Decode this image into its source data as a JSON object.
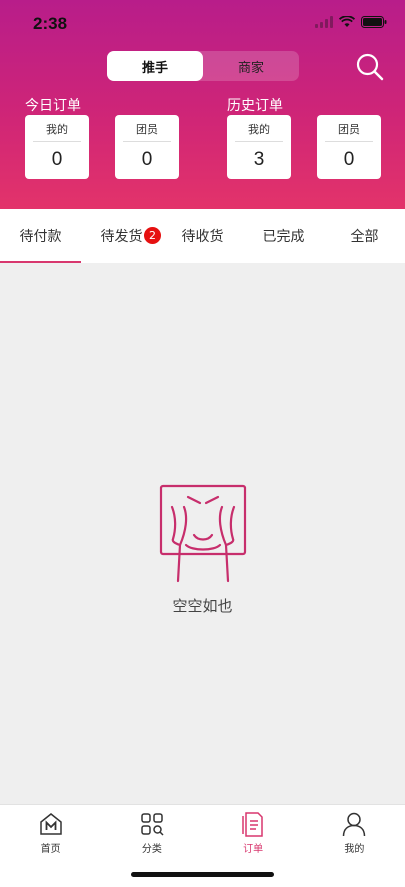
{
  "status_bar": {
    "time": "2:38"
  },
  "role_toggle": {
    "options": [
      "推手",
      "商家"
    ],
    "selected": "推手"
  },
  "today_orders": {
    "title": "今日订单",
    "cards": [
      {
        "label": "我的",
        "value": "0"
      },
      {
        "label": "团员",
        "value": "0"
      }
    ]
  },
  "history_orders": {
    "title": "历史订单",
    "cards": [
      {
        "label": "我的",
        "value": "3"
      },
      {
        "label": "团员",
        "value": "0"
      }
    ]
  },
  "tabs": [
    {
      "label": "待付款",
      "active": true
    },
    {
      "label": "待发货",
      "badge": "2"
    },
    {
      "label": "待收货"
    },
    {
      "label": "已完成"
    },
    {
      "label": "全部"
    }
  ],
  "empty_state": {
    "text": "空空如也"
  },
  "bottom_nav": {
    "items": [
      {
        "label": "首页",
        "icon": "home-icon"
      },
      {
        "label": "分类",
        "icon": "category-icon"
      },
      {
        "label": "订单",
        "icon": "orders-icon",
        "active": true
      },
      {
        "label": "我的",
        "icon": "user-icon"
      }
    ]
  },
  "colors": {
    "accent": "#d8376e",
    "badge": "#e61010",
    "header_top": "#b81d8a",
    "header_bottom": "#e3336a"
  }
}
